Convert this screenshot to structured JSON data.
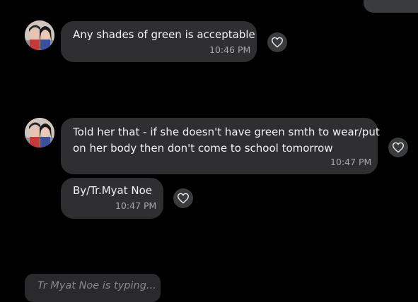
{
  "messages": [
    {
      "text": "Any shades of green is acceptable",
      "time": "10:46 PM"
    },
    {
      "lines": [
        "Told her that - if she doesn't have green smth to wear/put",
        "on her body then don't come to school tomorrow"
      ],
      "time": "10:47 PM"
    },
    {
      "text": "By/Tr.Myat Noe",
      "time": "10:47 PM"
    }
  ],
  "typing_indicator": "Tr Myat Noe is typing...",
  "icons": {
    "reaction": "heart-icon",
    "avatar": "avatar"
  },
  "colors": {
    "background": "#000000",
    "bubble": "#2f2f31",
    "reaction_button": "#3a3b3d",
    "time": "#a7a7a9",
    "typing_text": "#8a8a8c"
  }
}
